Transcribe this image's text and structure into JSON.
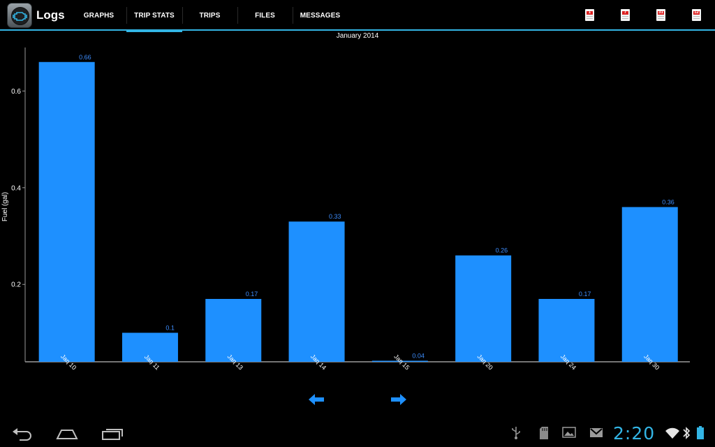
{
  "app": {
    "title": "Logs"
  },
  "tabs": [
    {
      "label": "GRAPHS",
      "selected": false
    },
    {
      "label": "TRIP STATS",
      "selected": true
    },
    {
      "label": "TRIPS",
      "selected": false
    },
    {
      "label": "FILES",
      "selected": false
    },
    {
      "label": "MESSAGES",
      "selected": false
    }
  ],
  "calendar_actions": [
    {
      "icon": "calendar-day-icon",
      "label": "1"
    },
    {
      "icon": "calendar-week-icon",
      "label": "7"
    },
    {
      "icon": "calendar-month-icon",
      "label": "31"
    },
    {
      "icon": "calendar-year-icon",
      "label": "12"
    }
  ],
  "chart_data": {
    "type": "bar",
    "title": "January 2014",
    "xlabel": "",
    "ylabel": "Fuel (gal)",
    "categories": [
      "Jan 10",
      "Jan 11",
      "Jan 13",
      "Jan 14",
      "Jan 15",
      "Jan 20",
      "Jan 24",
      "Jan 30"
    ],
    "values": [
      0.66,
      0.1,
      0.17,
      0.33,
      0.04,
      0.26,
      0.17,
      0.36
    ],
    "value_labels": [
      "0.66",
      "0.1",
      "0.17",
      "0.33",
      "0.04",
      "0.26",
      "0.17",
      "0.36"
    ],
    "value_axis_start": 0.04,
    "ylim": [
      0.04,
      0.69
    ],
    "yticks": [
      0.2,
      0.4,
      0.6
    ],
    "ytick_labels": [
      "0.2",
      "0.4",
      "0.6"
    ],
    "grid": false,
    "bar_color": "#1e90ff",
    "label_color": "#3d8eff"
  },
  "navigation": {
    "prev_icon": "arrow-left-icon",
    "next_icon": "arrow-right-icon",
    "color": "#1e90ff"
  },
  "system_bar": {
    "time": "2:20",
    "accent": "#33b5e5",
    "buttons": [
      "back-icon",
      "home-icon",
      "recent-apps-icon"
    ],
    "status_icons": [
      "usb-icon",
      "sd-card-icon",
      "picture-icon",
      "gmail-icon",
      "wifi-icon",
      "bluetooth-icon",
      "battery-icon"
    ]
  }
}
